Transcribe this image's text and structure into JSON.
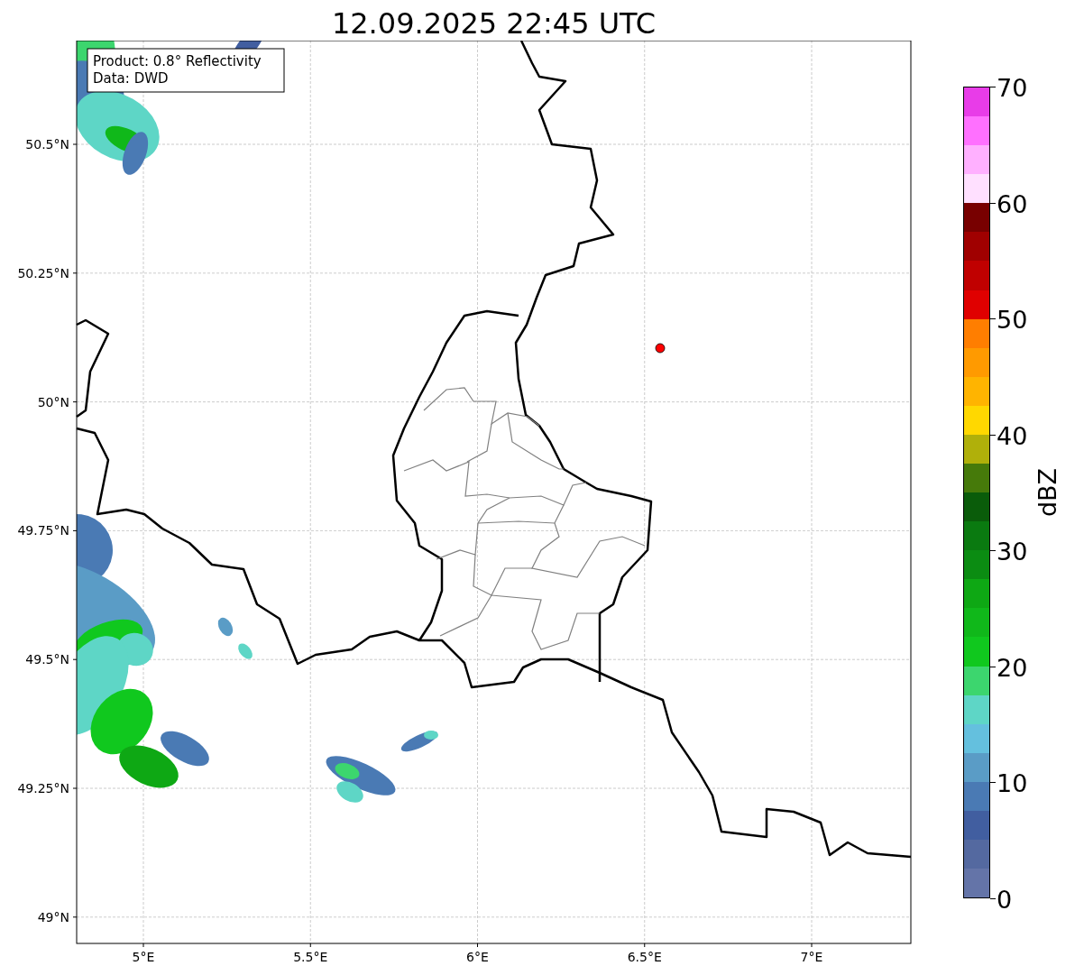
{
  "title": "12.09.2025 22:45 UTC",
  "info_box": [
    "Product: 0.8° Reflectivity",
    "Data: DWD"
  ],
  "map": {
    "lat_ticks": [
      "50.5°N",
      "50.25°N",
      "50°N",
      "49.75°N",
      "49.5°N",
      "49.25°N",
      "49°N"
    ],
    "lon_ticks": [
      "5°E",
      "5.5°E",
      "6°E",
      "6.5°E",
      "7°E"
    ]
  },
  "colorbar": {
    "label": "dBZ",
    "ticks": [
      "70",
      "60",
      "50",
      "40",
      "30",
      "20",
      "10",
      "0"
    ],
    "colors": [
      {
        "color": "#e83ce8"
      },
      {
        "color": "#ff70ff"
      },
      {
        "color": "#ffb0ff"
      },
      {
        "color": "#ffe0ff"
      },
      {
        "color": "#780000"
      },
      {
        "color": "#a00000"
      },
      {
        "color": "#c00000"
      },
      {
        "color": "#e00000"
      },
      {
        "color": "#ff7e00"
      },
      {
        "color": "#ff9a00"
      },
      {
        "color": "#ffb400"
      },
      {
        "color": "#ffd800"
      },
      {
        "color": "#b0b00a"
      },
      {
        "color": "#467a0a"
      },
      {
        "color": "#0a5c0a"
      },
      {
        "color": "#0a7a10"
      },
      {
        "color": "#0b8c12"
      },
      {
        "color": "#0ea814"
      },
      {
        "color": "#10b81a"
      },
      {
        "color": "#10c81e"
      },
      {
        "color": "#3cd66e"
      },
      {
        "color": "#5ed6c6"
      },
      {
        "color": "#64c0de"
      },
      {
        "color": "#5a9cc6"
      },
      {
        "color": "#4a7ab4"
      },
      {
        "color": "#415ea0"
      },
      {
        "color": "#5469a0"
      },
      {
        "color": "#6474a8"
      }
    ]
  }
}
